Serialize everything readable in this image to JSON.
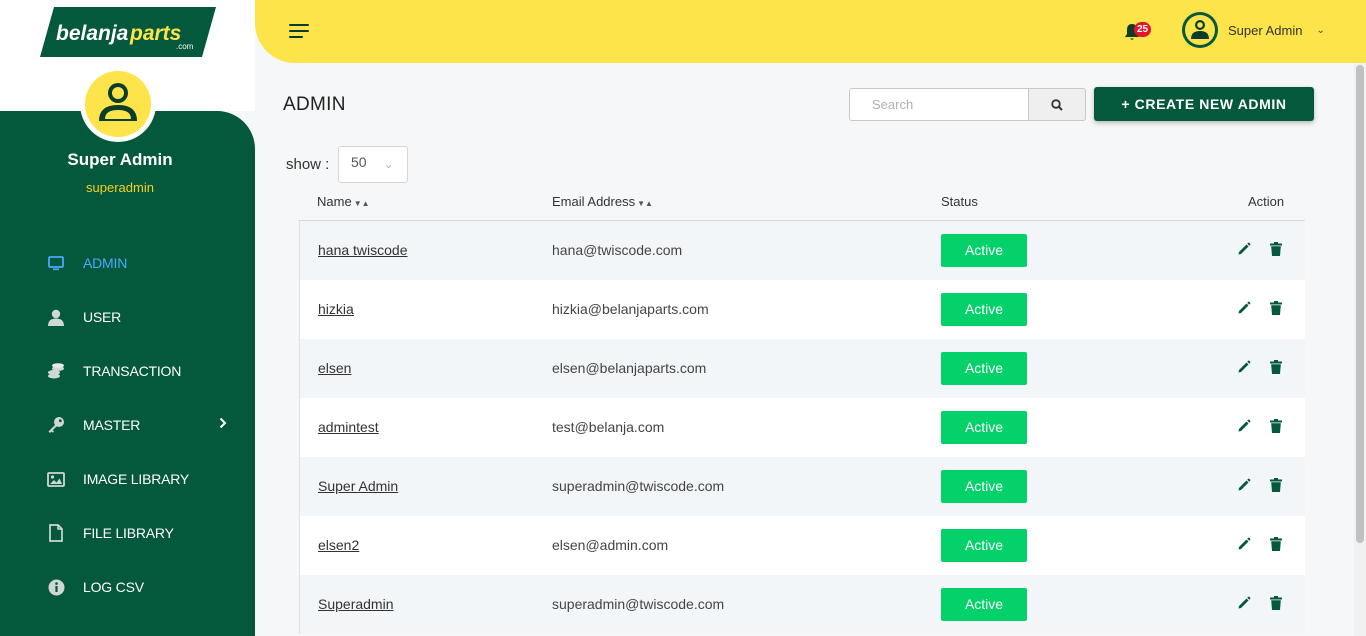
{
  "brand": {
    "logo_main": "belanja",
    "logo_accent": "parts",
    "logo_sub": ".com"
  },
  "user": {
    "name": "Super Admin",
    "role": "superadmin"
  },
  "header": {
    "notification_count": "25",
    "user_name": "Super Admin"
  },
  "sidebar": {
    "items": [
      {
        "label": "ADMIN",
        "icon": "monitor-icon",
        "active": true
      },
      {
        "label": "USER",
        "icon": "user-icon"
      },
      {
        "label": "TRANSACTION",
        "icon": "coins-icon"
      },
      {
        "label": "MASTER",
        "icon": "key-icon",
        "has_children": true
      },
      {
        "label": "IMAGE LIBRARY",
        "icon": "image-icon"
      },
      {
        "label": "FILE LIBRARY",
        "icon": "file-icon"
      },
      {
        "label": "LOG CSV",
        "icon": "info-icon"
      }
    ]
  },
  "page": {
    "title": "ADMIN",
    "search_placeholder": "Search",
    "create_label": "+ CREATE NEW ADMIN",
    "show_label": "show :",
    "show_value": "50"
  },
  "table": {
    "headers": {
      "name": "Name",
      "email": "Email Address",
      "status": "Status",
      "action": "Action"
    },
    "rows": [
      {
        "name": "hana twiscode",
        "email": "hana@twiscode.com",
        "status": "Active"
      },
      {
        "name": "hizkia",
        "email": "hizkia@belanjaparts.com",
        "status": "Active"
      },
      {
        "name": "elsen",
        "email": "elsen@belanjaparts.com",
        "status": "Active"
      },
      {
        "name": "admintest",
        "email": "test@belanja.com",
        "status": "Active"
      },
      {
        "name": "Super Admin",
        "email": "superadmin@twiscode.com",
        "status": "Active"
      },
      {
        "name": "elsen2",
        "email": "elsen@admin.com",
        "status": "Active"
      },
      {
        "name": "Superadmin",
        "email": "superadmin@twiscode.com",
        "status": "Active"
      }
    ]
  },
  "colors": {
    "brand_green": "#04583c",
    "brand_yellow": "#fde44a",
    "status_green": "#05d16b",
    "active_blue": "#4ba7ff",
    "badge_red": "#e5152b"
  }
}
